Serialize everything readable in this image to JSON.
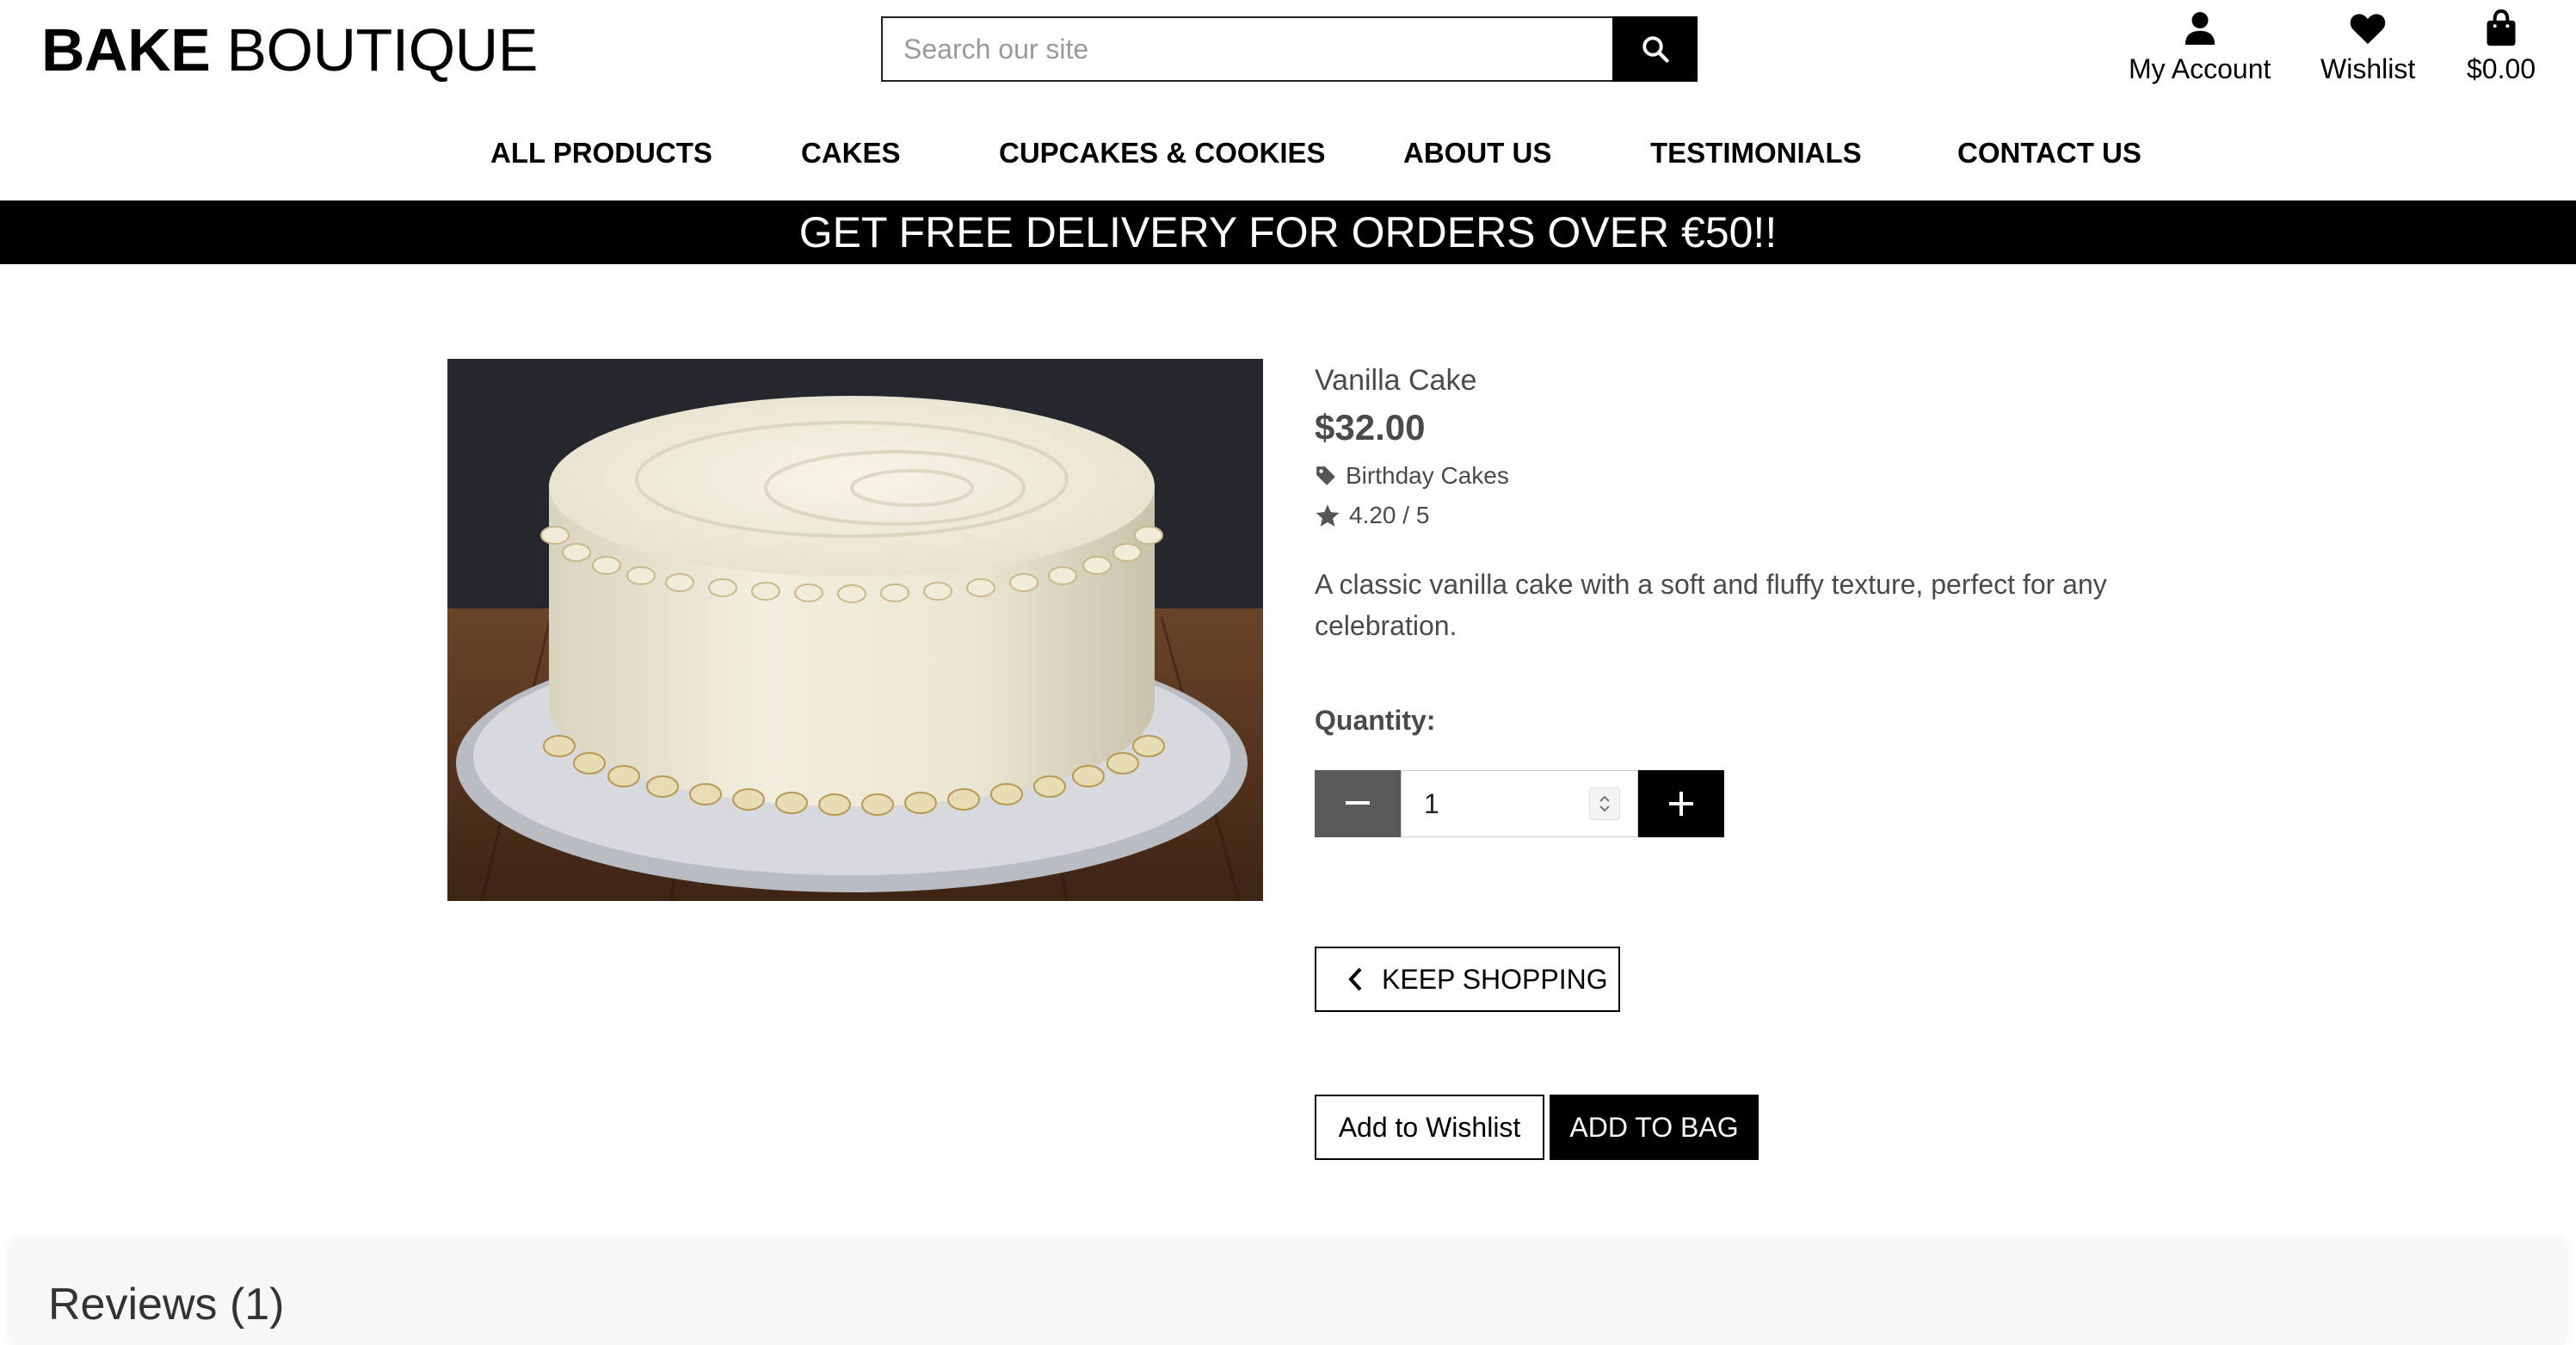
{
  "header": {
    "brand_bold": "BAKE",
    "brand_light": "BOUTIQUE",
    "search_placeholder": "Search our site",
    "account_label": "My Account",
    "wishlist_label": "Wishlist",
    "bag_total": "$0.00"
  },
  "nav": {
    "items": [
      "ALL PRODUCTS",
      "CAKES",
      "CUPCAKES & COOKIES",
      "ABOUT US",
      "TESTIMONIALS",
      "CONTACT US"
    ]
  },
  "banner": {
    "text": "GET FREE DELIVERY FOR ORDERS OVER €50!!"
  },
  "product": {
    "name": "Vanilla Cake",
    "price": "$32.00",
    "category": "Birthday Cakes",
    "rating": "4.20 / 5",
    "description": "A classic vanilla cake with a soft and fluffy texture, perfect for any celebration.",
    "quantity_label": "Quantity:",
    "quantity_value": "1"
  },
  "actions": {
    "keep_shopping": "KEEP SHOPPING",
    "add_to_wishlist": "Add to Wishlist",
    "add_to_bag": "ADD TO BAG"
  },
  "reviews": {
    "heading": "Reviews (1)"
  },
  "icons": {
    "search": "search-icon",
    "account": "user-icon",
    "wishlist": "heart-icon",
    "bag": "shopping-bag-icon",
    "category": "tag-icon",
    "rating": "star-icon",
    "minus": "minus-icon",
    "plus": "plus-icon",
    "back": "chevron-left-icon"
  }
}
